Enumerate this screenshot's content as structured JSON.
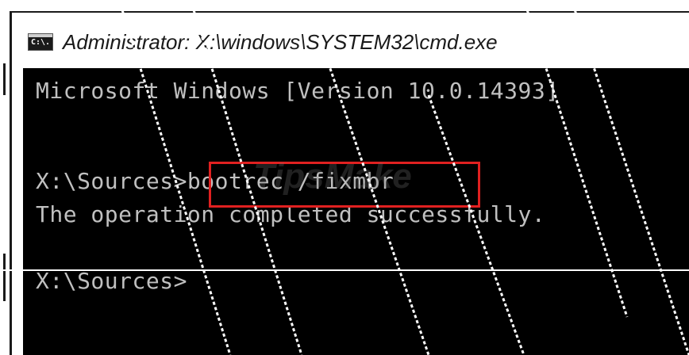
{
  "window": {
    "title": "Administrator: X:\\windows\\SYSTEM32\\cmd.exe",
    "icon": "cmd-icon",
    "icon_glyph": "C:\\."
  },
  "console": {
    "lines": [
      "Microsoft Windows [Version 10.0.14393]",
      "",
      "X:\\Sources>bootrec /fixmbr",
      "The operation completed successfully.",
      "",
      "X:\\Sources>"
    ]
  },
  "watermark": {
    "text": "TipsMake"
  },
  "colors": {
    "console_background": "#000000",
    "console_text": "#c0c0c0",
    "highlight_border": "#e02020"
  }
}
